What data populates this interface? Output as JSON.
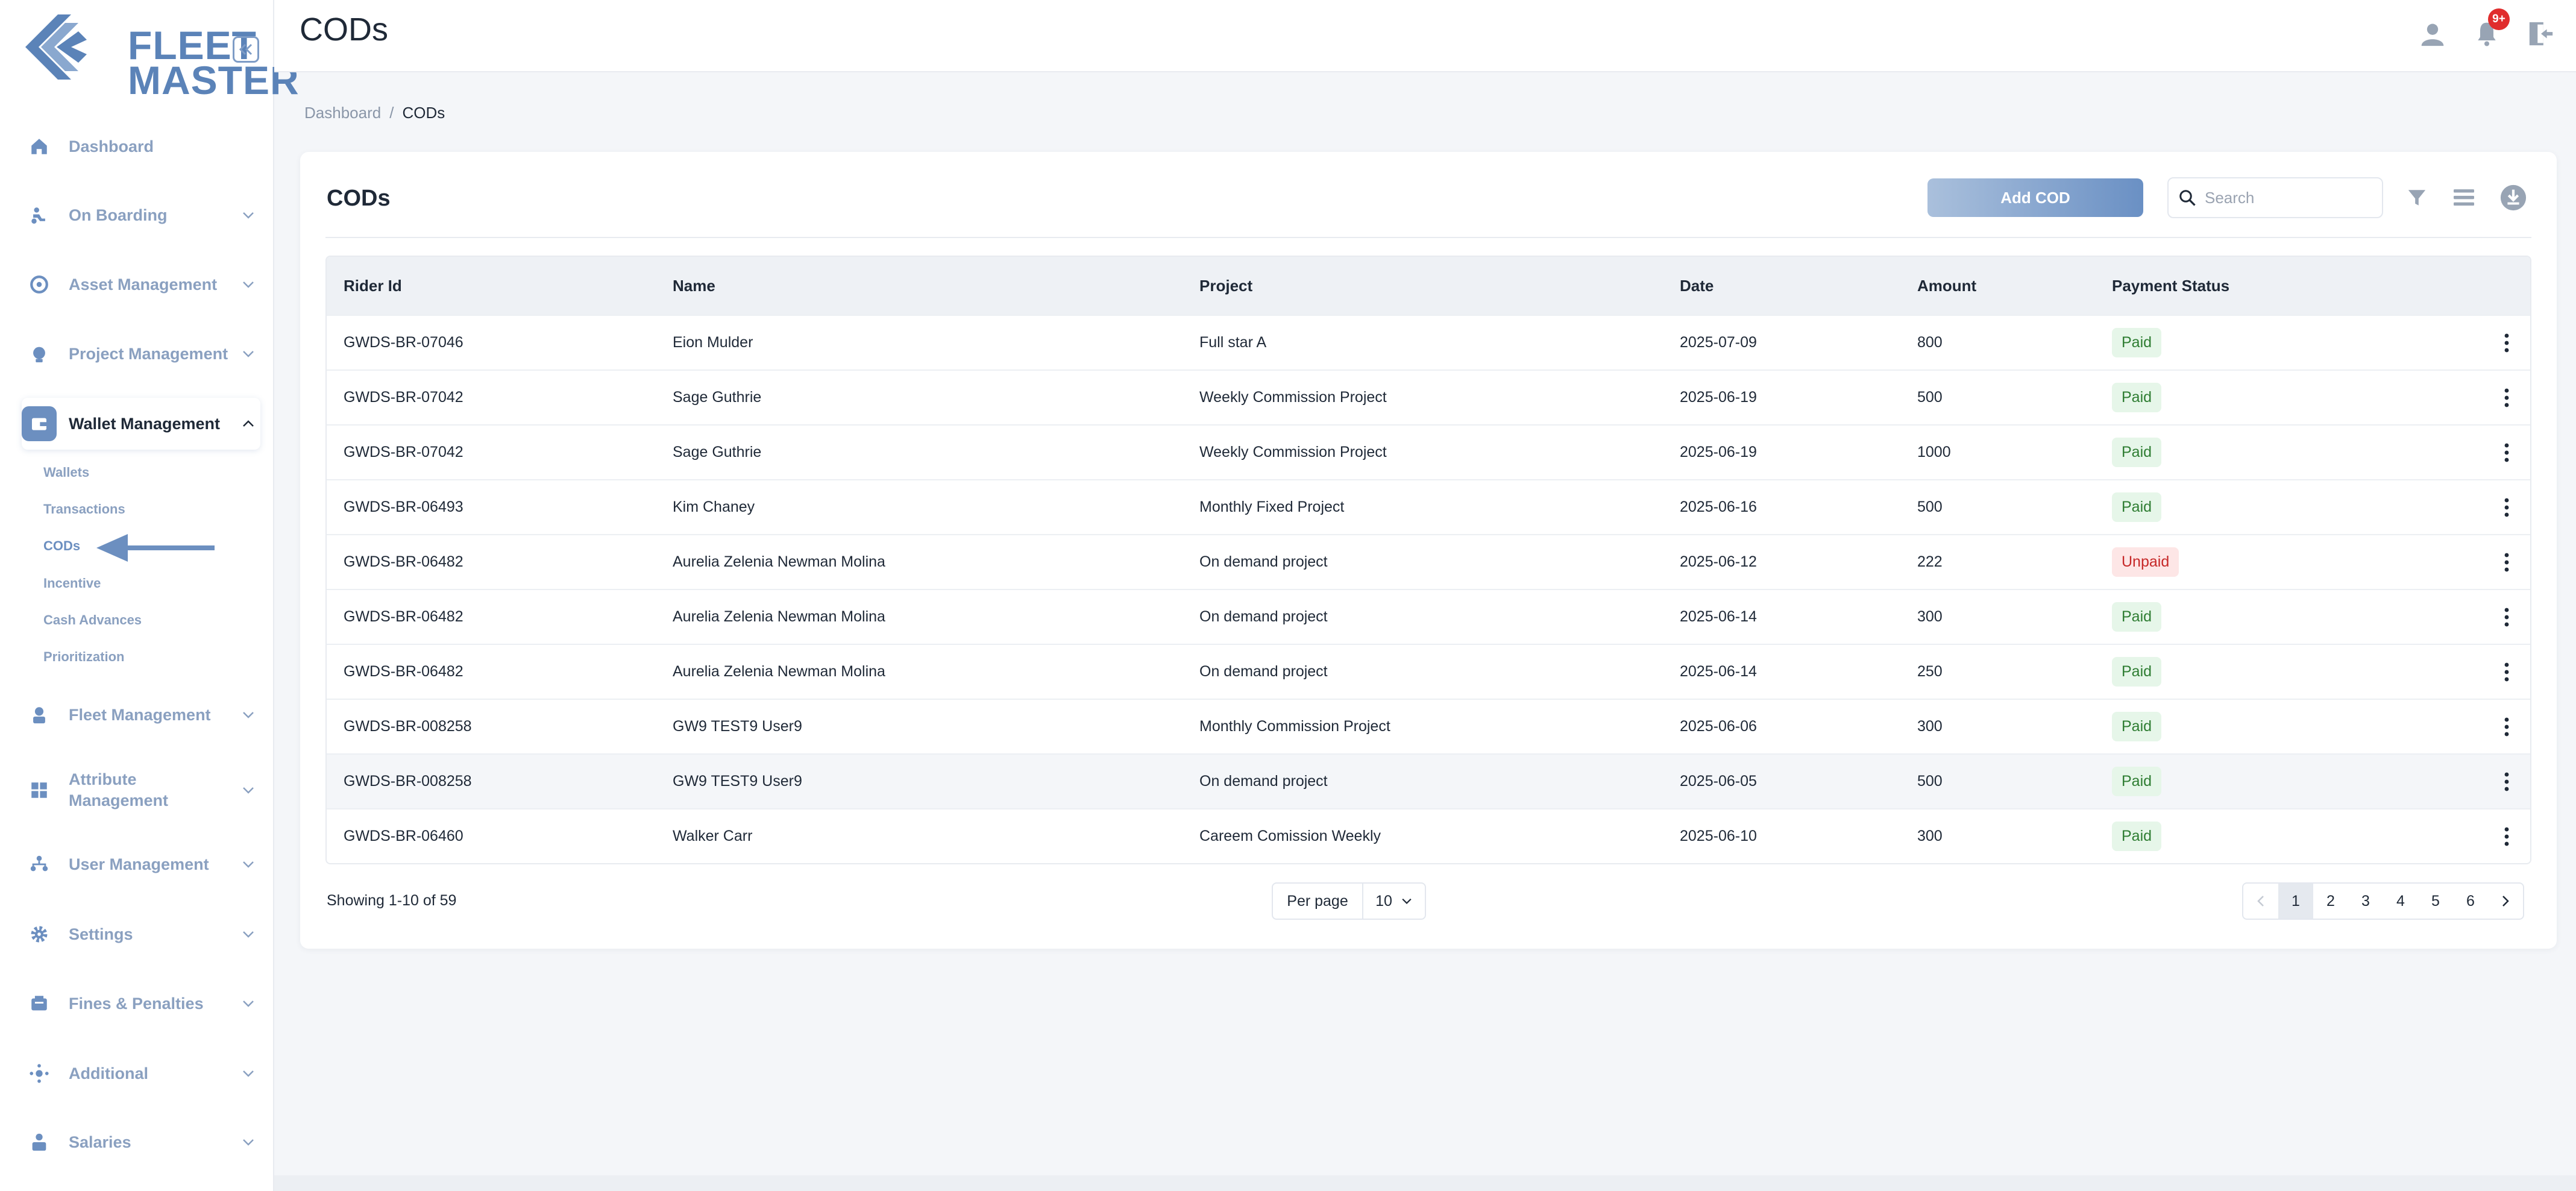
{
  "app": {
    "logo_line1": "FLEET",
    "logo_line2": "MASTER",
    "page_title": "CODs",
    "notification_count": "9+"
  },
  "colors": {
    "accent": "#6c8fc0",
    "sidebar_text": "#8aa0c0",
    "paid_bg": "#e6f6e9",
    "paid_text": "#2e7d32",
    "unpaid_bg": "#fde6e6",
    "unpaid_text": "#c62828"
  },
  "sidebar": {
    "items": [
      {
        "label": "Dashboard",
        "icon": "home-icon"
      },
      {
        "label": "On Boarding",
        "icon": "rider-icon"
      },
      {
        "label": "Asset Management",
        "icon": "asset-icon"
      },
      {
        "label": "Project Management",
        "icon": "project-icon"
      },
      {
        "label": "Wallet Management",
        "icon": "wallet-icon"
      },
      {
        "label": "Fleet Management",
        "icon": "fleet-icon"
      },
      {
        "label": "Attribute Management",
        "icon": "attribute-icon"
      },
      {
        "label": "User Management",
        "icon": "users-icon"
      },
      {
        "label": "Settings",
        "icon": "gear-icon"
      },
      {
        "label": "Fines & Penalties",
        "icon": "fines-icon"
      },
      {
        "label": "Additional",
        "icon": "additional-icon"
      },
      {
        "label": "Salaries",
        "icon": "salary-icon"
      }
    ],
    "wallet_sub": [
      "Wallets",
      "Transactions",
      "CODs",
      "Incentive",
      "Cash Advances",
      "Prioritization"
    ]
  },
  "breadcrumb": {
    "home": "Dashboard",
    "separator": "/",
    "current": "CODs"
  },
  "card": {
    "title": "CODs",
    "add_label": "Add COD",
    "search_placeholder": "Search"
  },
  "table": {
    "columns": [
      "Rider Id",
      "Name",
      "Project",
      "Date",
      "Amount",
      "Payment Status"
    ],
    "rows": [
      {
        "rider_id": "GWDS-BR-07046",
        "name": "Eion Mulder",
        "project": "Full star A",
        "date": "2025-07-09",
        "amount": "800",
        "status": "Paid"
      },
      {
        "rider_id": "GWDS-BR-07042",
        "name": "Sage Guthrie",
        "project": "Weekly Commission Project",
        "date": "2025-06-19",
        "amount": "500",
        "status": "Paid"
      },
      {
        "rider_id": "GWDS-BR-07042",
        "name": "Sage Guthrie",
        "project": "Weekly Commission Project",
        "date": "2025-06-19",
        "amount": "1000",
        "status": "Paid"
      },
      {
        "rider_id": "GWDS-BR-06493",
        "name": "Kim Chaney",
        "project": "Monthly Fixed Project",
        "date": "2025-06-16",
        "amount": "500",
        "status": "Paid"
      },
      {
        "rider_id": "GWDS-BR-06482",
        "name": "Aurelia Zelenia Newman Molina",
        "project": "On demand project",
        "date": "2025-06-12",
        "amount": "222",
        "status": "Unpaid"
      },
      {
        "rider_id": "GWDS-BR-06482",
        "name": "Aurelia Zelenia Newman Molina",
        "project": "On demand project",
        "date": "2025-06-14",
        "amount": "300",
        "status": "Paid"
      },
      {
        "rider_id": "GWDS-BR-06482",
        "name": "Aurelia Zelenia Newman Molina",
        "project": "On demand project",
        "date": "2025-06-14",
        "amount": "250",
        "status": "Paid"
      },
      {
        "rider_id": "GWDS-BR-008258",
        "name": "GW9 TEST9 User9",
        "project": "Monthly Commission Project",
        "date": "2025-06-06",
        "amount": "300",
        "status": "Paid"
      },
      {
        "rider_id": "GWDS-BR-008258",
        "name": "GW9 TEST9 User9",
        "project": "On demand project",
        "date": "2025-06-05",
        "amount": "500",
        "status": "Paid"
      },
      {
        "rider_id": "GWDS-BR-06460",
        "name": "Walker Carr",
        "project": "Careem Comission Weekly",
        "date": "2025-06-10",
        "amount": "300",
        "status": "Paid"
      }
    ]
  },
  "footer": {
    "showing": "Showing 1-10 of 59",
    "per_page_label": "Per page",
    "per_page_value": "10",
    "pages": [
      "1",
      "2",
      "3",
      "4",
      "5",
      "6"
    ],
    "current_page": "1"
  }
}
